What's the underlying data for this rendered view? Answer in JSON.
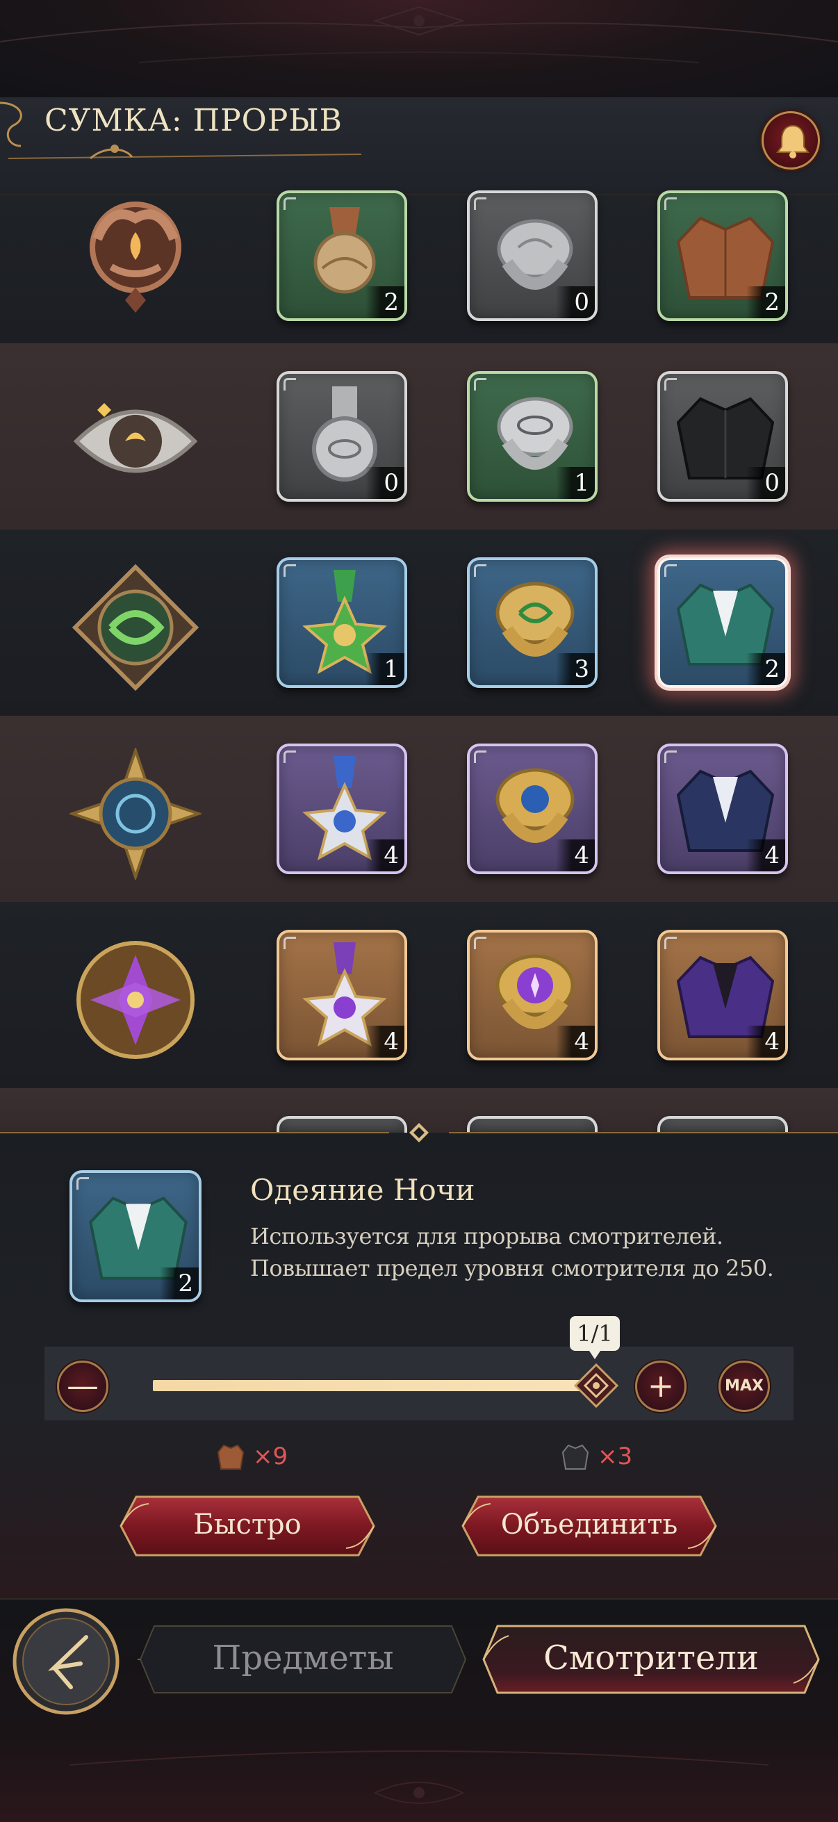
{
  "header": {
    "title": "СУМКА: ПРОРЫВ"
  },
  "rows": [
    {
      "emblem": "bronze-flame-emblem",
      "items": [
        {
          "name": "bronze-medal",
          "count": "2",
          "rarity": "green"
        },
        {
          "name": "silver-ring",
          "count": "0",
          "rarity": "grey"
        },
        {
          "name": "brown-jacket",
          "count": "2",
          "rarity": "green"
        }
      ]
    },
    {
      "emblem": "silver-eye-emblem",
      "items": [
        {
          "name": "silver-medal",
          "count": "0",
          "rarity": "grey"
        },
        {
          "name": "eye-ring",
          "count": "1",
          "rarity": "green"
        },
        {
          "name": "black-jacket",
          "count": "0",
          "rarity": "grey"
        }
      ]
    },
    {
      "emblem": "green-knot-emblem",
      "items": [
        {
          "name": "green-star-medal",
          "count": "1",
          "rarity": "blue"
        },
        {
          "name": "gold-green-ring",
          "count": "3",
          "rarity": "blue"
        },
        {
          "name": "green-jacket",
          "count": "2",
          "rarity": "blue",
          "selected": true
        }
      ]
    },
    {
      "emblem": "blue-star-emblem",
      "items": [
        {
          "name": "blue-star-medal",
          "count": "4",
          "rarity": "purple"
        },
        {
          "name": "gold-blue-ring",
          "count": "4",
          "rarity": "purple"
        },
        {
          "name": "navy-jacket",
          "count": "4",
          "rarity": "purple"
        }
      ]
    },
    {
      "emblem": "purple-gem-emblem",
      "items": [
        {
          "name": "purple-star-medal",
          "count": "4",
          "rarity": "orange"
        },
        {
          "name": "purple-gem-ring",
          "count": "4",
          "rarity": "orange"
        },
        {
          "name": "purple-jacket",
          "count": "4",
          "rarity": "orange"
        }
      ]
    }
  ],
  "detail": {
    "item_count": "2",
    "name": "Одеяние Ночи",
    "description_line1": "Используется для прорыва смотрителей.",
    "description_line2": "Повышает предел уровня смотрителя до 250."
  },
  "quantity": {
    "badge": "1/1",
    "fill_fraction": 1.0,
    "minus_glyph": "—",
    "plus_glyph": "+",
    "max_label": "MAX"
  },
  "costs": [
    {
      "icon": "brown-jacket-icon",
      "amount": "×9"
    },
    {
      "icon": "black-jacket-icon",
      "amount": "×3"
    }
  ],
  "actions": {
    "quick_label": "Быстро",
    "merge_label": "Объединить"
  },
  "nav": {
    "items_tab": "Предметы",
    "keepers_tab": "Смотрители",
    "active_tab": "keepers"
  },
  "colors": {
    "accent_gold": "#c9a063",
    "button_red": "#8a1f27",
    "cost_red": "#e05656"
  }
}
